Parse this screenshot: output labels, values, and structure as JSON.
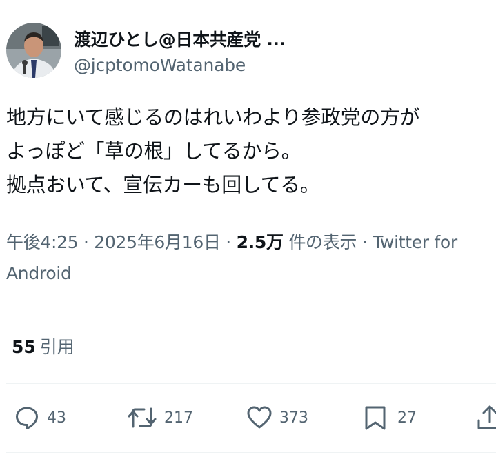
{
  "author": {
    "display_name": "渡辺ひとし@日本共産党 ...",
    "handle": "@jcptomoWatanabe",
    "avatar_icon": "profile-photo"
  },
  "tweet": {
    "lines": [
      "地方にいて感じるのはれいわより参政党の方が",
      "よっぽど「草の根」してるから。",
      "拠点おいて、宣伝カーも回してる。"
    ]
  },
  "meta": {
    "time": "午後4:25",
    "sep1": " · ",
    "date": "2025年6月16日",
    "sep2": " · ",
    "views_count": "2.5万",
    "views_label": " 件の表示",
    "sep3": " · ",
    "source": "Twitter for Android"
  },
  "quotes": {
    "count": "55",
    "label": "引用"
  },
  "actions": {
    "reply": {
      "icon": "reply-icon",
      "count": "43"
    },
    "retweet": {
      "icon": "retweet-icon",
      "count": "217"
    },
    "like": {
      "icon": "heart-icon",
      "count": "373"
    },
    "bookmark": {
      "icon": "bookmark-icon",
      "count": "27"
    },
    "share": {
      "icon": "share-icon"
    }
  },
  "colors": {
    "text_primary": "#0f1419",
    "text_secondary": "#536471",
    "divider": "#eff3f4"
  }
}
